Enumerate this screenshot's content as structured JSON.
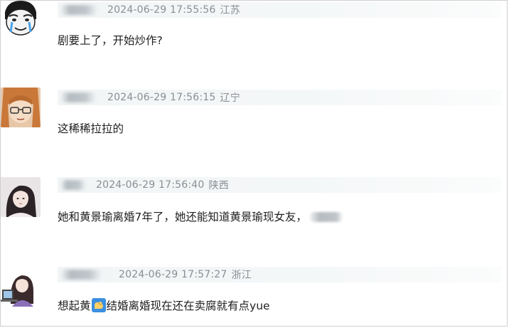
{
  "comments": [
    {
      "timestamp": "2024-06-29 17:55:56",
      "location": "江苏",
      "text": "剧要上了，开始炒作?",
      "avatar": "meme-face-avatar"
    },
    {
      "timestamp": "2024-06-29 17:56:15",
      "location": "辽宁",
      "text": "这稀稀拉拉的",
      "avatar": "anime-glasses-avatar"
    },
    {
      "timestamp": "2024-06-29 17:56:40",
      "location": "陕西",
      "text": "她和黄景瑜离婚7年了，她还能知道黄景瑜现女友，",
      "avatar": "girl-photo-avatar"
    },
    {
      "timestamp": "2024-06-29 17:57:27",
      "location": "浙江",
      "text_before": "想起黄",
      "text_after": "结婚离婚现在还在卖腐就有点yue",
      "emoji": "flexed-arm-icon",
      "avatar": "girl-computer-avatar"
    }
  ],
  "colors": {
    "meta_text": "#8a8e93",
    "meta_bar": "#f3f6f7",
    "comment_text": "#1f1f1f"
  }
}
